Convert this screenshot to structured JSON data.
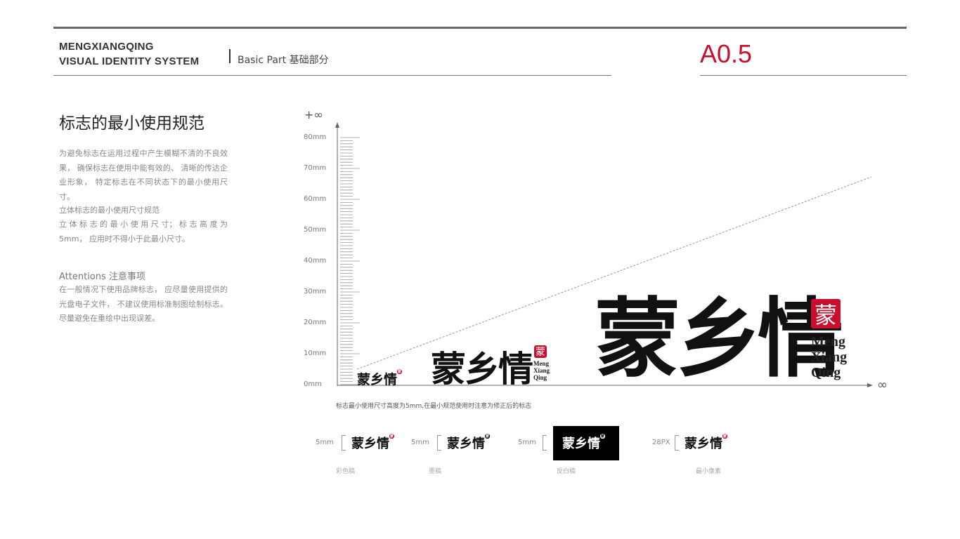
{
  "header": {
    "brand_line1": "MENGXIANGQING",
    "brand_line2": "VISUAL IDENTITY SYSTEM",
    "part": "Basic Part 基础部分",
    "page_code": "A0.5"
  },
  "section": {
    "title": "标志的最小使用规范",
    "paragraphs": [
      "为避免标志在运用过程中产生模糊不清的不良效果， 确保标志在使用中能有效的、 清晰的传达企业形象， 特定标志在不同状态下的最小使用尺寸。",
      "立体标志的最小使用尺寸规范",
      "立 体 标 志 的 最 小 使 用 尺 寸； 标 志 高 度 为 5mm， 应用时不得小于此最小尺寸。"
    ],
    "attention_title": "Attentions 注意事项",
    "attention_text": "在一般情况下使用品牌标志， 应尽量使用提供的光盘电子文件， 不建议使用标准制图绘制标志。 尽量避免在重绘中出现误差。"
  },
  "chart": {
    "y_top_label": "+∞",
    "x_end_label": "∞",
    "ticks": [
      "0mm",
      "10mm",
      "20mm",
      "30mm",
      "40mm",
      "50mm",
      "60mm",
      "70mm",
      "80mm"
    ],
    "caption": "标志最小使用尺寸高度为5mm,在最小规范使用时注意为修正后的标志"
  },
  "logo": {
    "chinese": "蒙乡情",
    "seal": "蒙",
    "english": [
      "Meng",
      "Xiang",
      "Qing"
    ]
  },
  "variants": [
    {
      "size": "5mm",
      "label": "彩色稿"
    },
    {
      "size": "5mm",
      "label": "墨稿"
    },
    {
      "size": "5mm",
      "label": "反白稿"
    },
    {
      "size": "28PX",
      "label": "最小像素"
    }
  ],
  "colors": {
    "accent": "#c8102e",
    "text": "#333333"
  }
}
